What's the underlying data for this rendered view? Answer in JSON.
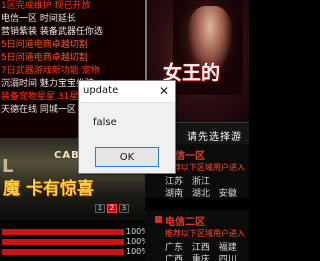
{
  "news": [
    "1区完成维护 现已开放",
    "电信一区 时间延长",
    "营销紫装 装备武器任你选",
    "5日问道电商卓越切割",
    "5日问道电商卓越切割",
    "7日武器游戏新功能 宠物",
    "沉溺时间 魅力宝宝坐骑",
    "装备宠物星星 31星转转送",
    "天德在线 同城一区 新开"
  ],
  "banner": {
    "left_glyph": "L",
    "brand": "CABA",
    "promo": "魔 卡有惊喜",
    "pages": [
      "1",
      "2",
      "3"
    ],
    "active_page": "2"
  },
  "bars": [
    {
      "percent": "100%",
      "fill": 1.0,
      "color": "#c81414"
    },
    {
      "percent": "100%",
      "fill": 1.0,
      "color": "#c81414"
    },
    {
      "percent": "100%",
      "fill": 1.0,
      "color": "#c81414"
    }
  ],
  "hero": {
    "title": "女王的"
  },
  "select_header": "请先选择游",
  "zones": [
    {
      "title": "电信一区",
      "hint": "推荐以下区域用户进入",
      "rows": [
        "江苏 浙江",
        "湖南 湖北 安徽"
      ]
    },
    {
      "title": "电信二区",
      "hint": "推荐以下区域用户进入",
      "rows": [
        "广东 江西 福建",
        "广西 重庆 四川"
      ]
    }
  ],
  "dialog": {
    "title": "update",
    "message": "false",
    "ok_label": "OK",
    "close_glyph": "✕"
  },
  "colors": {
    "accent": "#e83a2a",
    "dialog_button_border": "#2a7fd4"
  }
}
